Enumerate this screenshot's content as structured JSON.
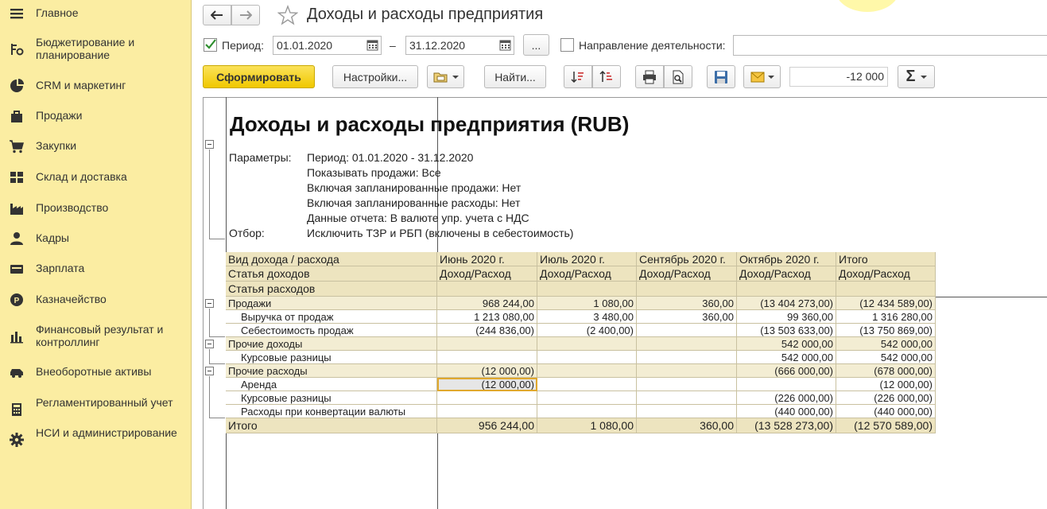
{
  "sidebar": {
    "items": [
      {
        "label": "Главное",
        "icon": "menu-icon"
      },
      {
        "label": "Бюджетирование и планирование",
        "icon": "budget-icon"
      },
      {
        "label": "CRM и маркетинг",
        "icon": "pie-chart-icon"
      },
      {
        "label": "Продажи",
        "icon": "shopping-bag-icon"
      },
      {
        "label": "Закупки",
        "icon": "shopping-cart-icon"
      },
      {
        "label": "Склад и доставка",
        "icon": "warehouse-icon"
      },
      {
        "label": "Производство",
        "icon": "factory-icon"
      },
      {
        "label": "Кадры",
        "icon": "person-icon"
      },
      {
        "label": "Зарплата",
        "icon": "wallet-icon"
      },
      {
        "label": "Казначейство",
        "icon": "coin-icon"
      },
      {
        "label": "Финансовый результат и контроллинг",
        "icon": "bar-chart-icon"
      },
      {
        "label": "Внеоборотные активы",
        "icon": "car-icon"
      },
      {
        "label": "Регламентированный учет",
        "icon": "calculator-icon"
      },
      {
        "label": "НСИ и администрирование",
        "icon": "gear-icon"
      }
    ]
  },
  "header": {
    "title": "Доходы и расходы предприятия",
    "period_label": "Период:",
    "period_from": "01.01.2020",
    "period_to": "31.12.2020",
    "dash": "–",
    "ellipsis_label": "...",
    "direction_label": "Направление деятельности:",
    "direction_value": "",
    "form_button": "Сформировать",
    "settings_button": "Настройки...",
    "find_button": "Найти...",
    "sum_value": "-12 000",
    "sigma": "Σ"
  },
  "report": {
    "title": "Доходы и расходы предприятия (RUB)",
    "params_label": "Параметры:",
    "params": [
      "Период: 01.01.2020 - 31.12.2020",
      "Показывать продажи: Все",
      "Включая запланированные продажи: Нет",
      "Включая запланированные расходы: Нет",
      "Данные отчета: В валюте упр. учета с НДС"
    ],
    "filter_label": "Отбор:",
    "filter_value": "Исключить ТЗР и РБП (включены в себестоимость)",
    "table": {
      "header_rows": [
        [
          "Вид дохода / расхода",
          "Июнь 2020 г.",
          "Июль 2020 г.",
          "Сентябрь 2020 г.",
          "Октябрь 2020 г.",
          "Итого"
        ],
        [
          "Статья доходов",
          "Доход/Расход",
          "Доход/Расход",
          "Доход/Расход",
          "Доход/Расход",
          "Доход/Расход"
        ],
        [
          "Статья расходов",
          "",
          "",
          "",
          "",
          ""
        ]
      ],
      "rows": [
        {
          "name": "Продажи",
          "level": 0,
          "values": [
            "968 244,00",
            "1 080,00",
            "360,00",
            "(13 404 273,00)",
            "(12 434 589,00)"
          ]
        },
        {
          "name": "Выручка от продаж",
          "level": 1,
          "values": [
            "1 213 080,00",
            "3 480,00",
            "360,00",
            "99 360,00",
            "1 316 280,00"
          ]
        },
        {
          "name": "Себестоимость продаж",
          "level": 1,
          "values": [
            "(244 836,00)",
            "(2 400,00)",
            "",
            "(13 503 633,00)",
            "(13 750 869,00)"
          ]
        },
        {
          "name": "Прочие доходы",
          "level": 0,
          "values": [
            "",
            "",
            "",
            "542 000,00",
            "542 000,00"
          ]
        },
        {
          "name": "Курсовые разницы",
          "level": 1,
          "values": [
            "",
            "",
            "",
            "542 000,00",
            "542 000,00"
          ]
        },
        {
          "name": "Прочие расходы",
          "level": 0,
          "values": [
            "(12 000,00)",
            "",
            "",
            "(666 000,00)",
            "(678 000,00)"
          ]
        },
        {
          "name": "Аренда",
          "level": 1,
          "values": [
            "(12 000,00)",
            "",
            "",
            "",
            "(12 000,00)"
          ]
        },
        {
          "name": "Курсовые разницы",
          "level": 1,
          "values": [
            "",
            "",
            "",
            "(226 000,00)",
            "(226 000,00)"
          ]
        },
        {
          "name": "Расходы при конвертации валюты",
          "level": 1,
          "values": [
            "",
            "",
            "",
            "(440 000,00)",
            "(440 000,00)"
          ]
        }
      ],
      "total": {
        "name": "Итого",
        "values": [
          "956 244,00",
          "1 080,00",
          "360,00",
          "(13 528 273,00)",
          "(12 570 589,00)"
        ]
      }
    }
  },
  "colors": {
    "sidebar_bg": "#fbeda2",
    "group_row_bg": "#f3edd3",
    "header_bg": "#ede4bf",
    "accent_yellow": "#f0c800"
  }
}
